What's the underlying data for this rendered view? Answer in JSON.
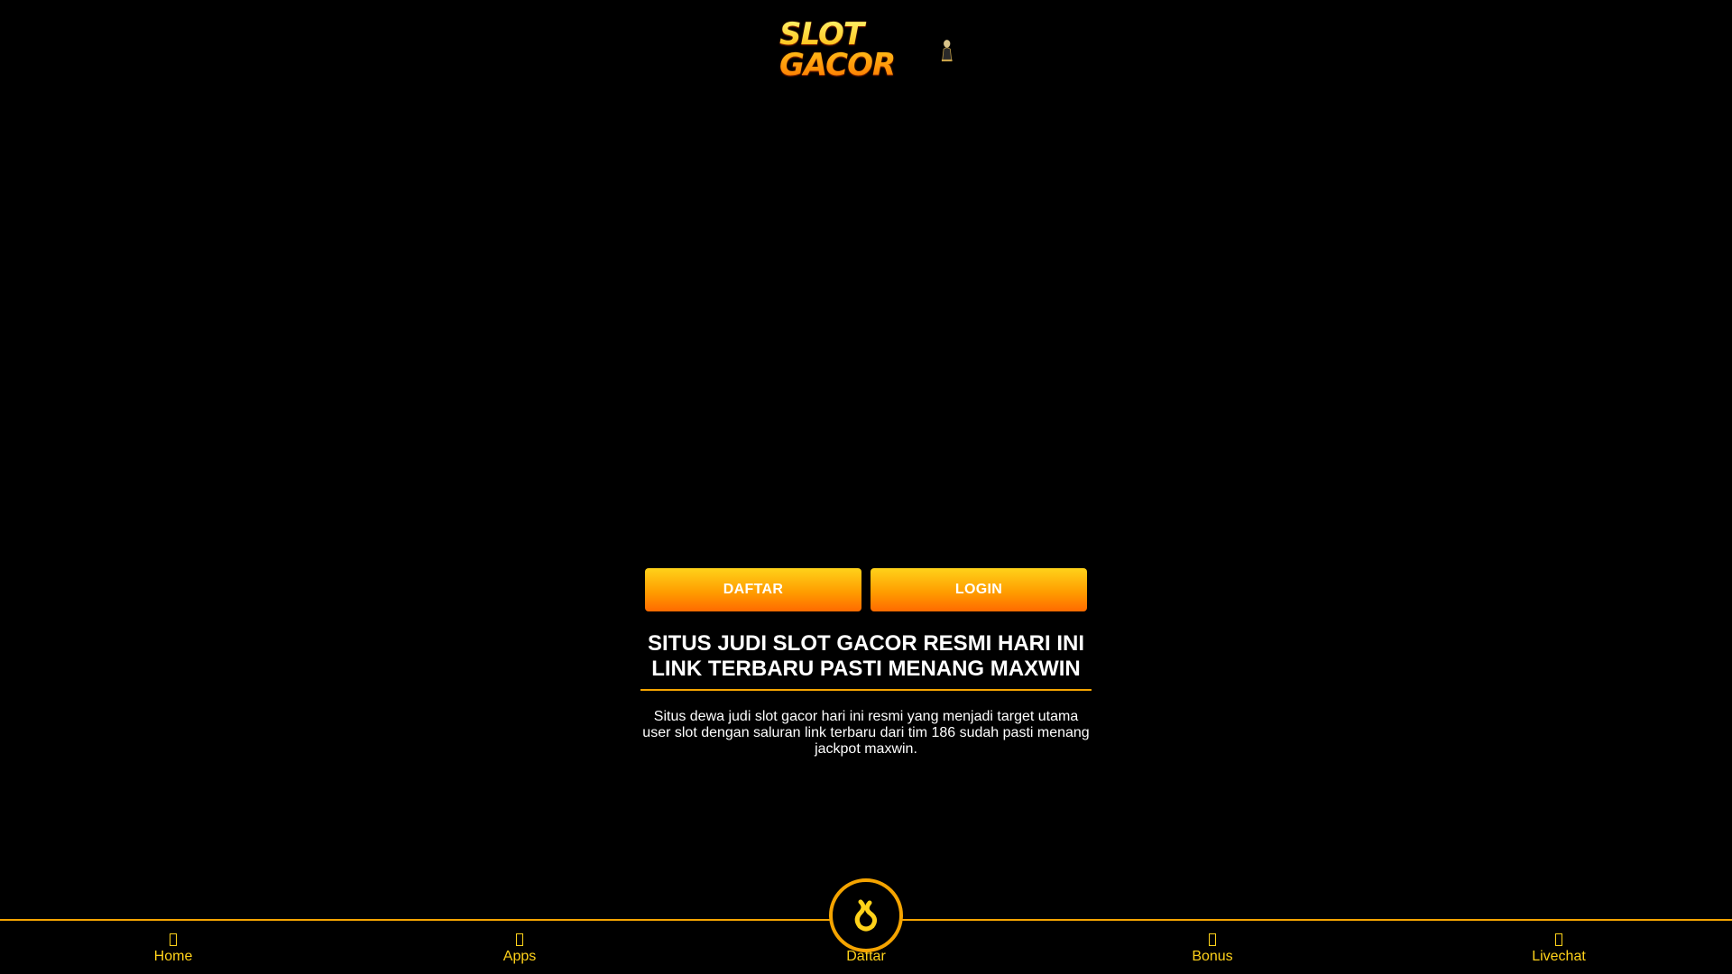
{
  "header": {
    "logo_text": "SLOT GACOR"
  },
  "actions": {
    "daftar_label": "DAFTAR",
    "login_label": "LOGIN"
  },
  "main": {
    "heading": "SITUS JUDI SLOT GACOR RESMI HARI INI LINK TERBARU PASTI MENANG MAXWIN",
    "description": "Situs dewa judi slot gacor hari ini resmi yang menjadi target utama user slot dengan saluran link terbaru dari tim 186 sudah pasti menang jackpot maxwin."
  },
  "bottom_nav": {
    "items": [
      {
        "label": "Home",
        "icon": "home-icon"
      },
      {
        "label": "Apps",
        "icon": "apps-icon"
      },
      {
        "label": "Daftar",
        "icon": "daftar-icon"
      },
      {
        "label": "Bonus",
        "icon": "gift-icon"
      },
      {
        "label": "Livechat",
        "icon": "chat-icon"
      }
    ]
  },
  "colors": {
    "accent": "#f5a400",
    "nav_text": "#ffd21a",
    "background": "#000000"
  }
}
